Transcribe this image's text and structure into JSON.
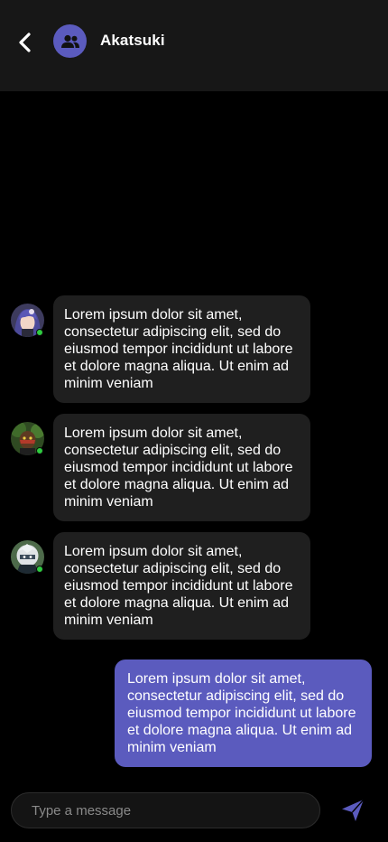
{
  "header": {
    "title": "Akatsuki",
    "back_icon": "chevron-left-icon",
    "group_icon": "group-users-icon"
  },
  "messages": [
    {
      "sender": "member-1",
      "outgoing": false,
      "online": true,
      "text": "Lorem ipsum dolor sit amet, consectetur adipiscing elit, sed do eiusmod tempor incididunt ut labore et dolore magna aliqua. Ut enim ad minim veniam"
    },
    {
      "sender": "member-2",
      "outgoing": false,
      "online": true,
      "text": "Lorem ipsum dolor sit amet, consectetur adipiscing elit, sed do eiusmod tempor incididunt ut labore et dolore magna aliqua. Ut enim ad minim veniam"
    },
    {
      "sender": "member-3",
      "outgoing": false,
      "online": true,
      "text": "Lorem ipsum dolor sit amet, consectetur adipiscing elit, sed do eiusmod tempor incididunt ut labore et dolore magna aliqua. Ut enim ad minim veniam"
    },
    {
      "sender": "me",
      "outgoing": true,
      "text": "Lorem ipsum dolor sit amet, consectetur adipiscing elit, sed do eiusmod tempor incididunt ut labore et dolore magna aliqua. Ut enim ad minim veniam"
    }
  ],
  "composer": {
    "placeholder": "Type a message",
    "send_icon": "send-paper-plane-icon"
  },
  "colors": {
    "accent": "#5b5bbe",
    "incoming_bubble": "#1f1f1f",
    "header_bg": "#171717",
    "online": "#2ecc40"
  }
}
